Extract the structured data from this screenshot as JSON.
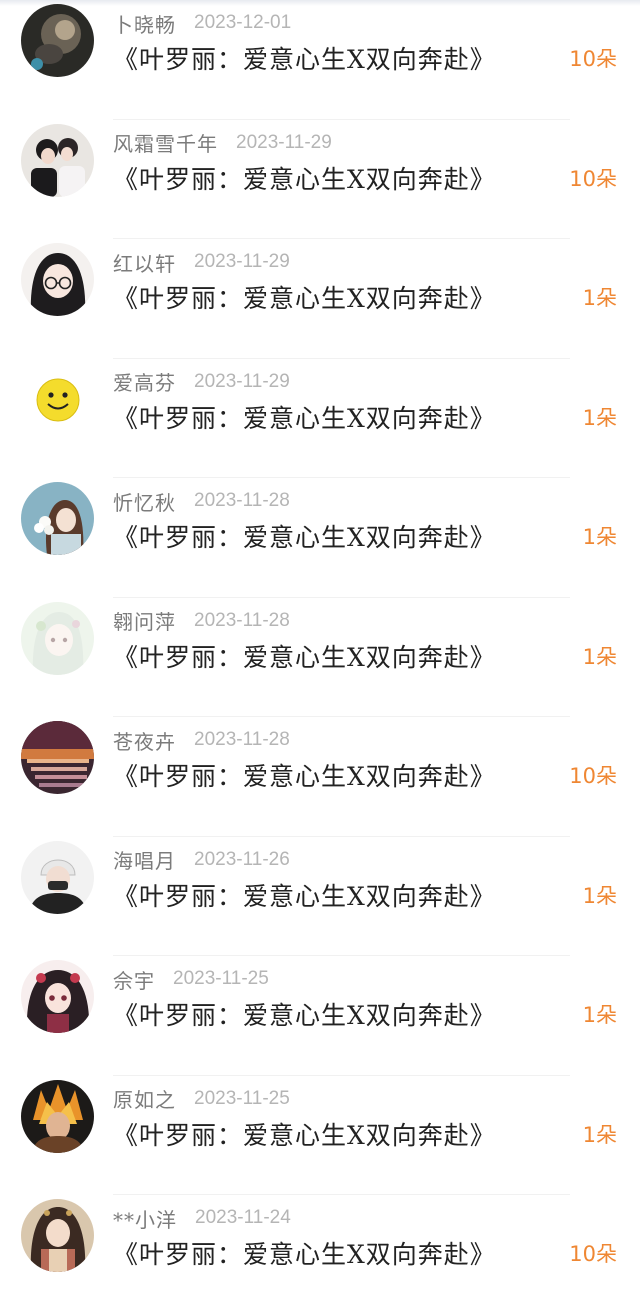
{
  "list": {
    "items": [
      {
        "user": "卜晓畅",
        "date": "2023-12-01",
        "gift": "《叶罗丽：爱意心生X双向奔赴》",
        "amount": "10朵",
        "avatar": "dark-photo-avatar"
      },
      {
        "user": "风霜雪千年",
        "date": "2023-11-29",
        "gift": "《叶罗丽：爱意心生X双向奔赴》",
        "amount": "10朵",
        "avatar": "couple-avatar"
      },
      {
        "user": "红以轩",
        "date": "2023-11-29",
        "gift": "《叶罗丽：爱意心生X双向奔赴》",
        "amount": "1朵",
        "avatar": "glasses-girl-avatar"
      },
      {
        "user": "爱高芬",
        "date": "2023-11-29",
        "gift": "《叶罗丽：爱意心生X双向奔赴》",
        "amount": "1朵",
        "avatar": "smiley-avatar"
      },
      {
        "user": "忻忆秋",
        "date": "2023-11-28",
        "gift": "《叶罗丽：爱意心生X双向奔赴》",
        "amount": "1朵",
        "avatar": "flower-girl-avatar"
      },
      {
        "user": "翱问萍",
        "date": "2023-11-28",
        "gift": "《叶罗丽：爱意心生X双向奔赴》",
        "amount": "1朵",
        "avatar": "pastel-girl-avatar"
      },
      {
        "user": "苍夜卉",
        "date": "2023-11-28",
        "gift": "《叶罗丽：爱意心生X双向奔赴》",
        "amount": "10朵",
        "avatar": "sunset-avatar"
      },
      {
        "user": "海唱月",
        "date": "2023-11-26",
        "gift": "《叶罗丽：爱意心生X双向奔赴》",
        "amount": "1朵",
        "avatar": "masked-boy-avatar"
      },
      {
        "user": "佘宇",
        "date": "2023-11-25",
        "gift": "《叶罗丽：爱意心生X双向奔赴》",
        "amount": "1朵",
        "avatar": "anime-girl-avatar"
      },
      {
        "user": "原如之",
        "date": "2023-11-25",
        "gift": "《叶罗丽：爱意心生X双向奔赴》",
        "amount": "1朵",
        "avatar": "fire-girl-avatar"
      },
      {
        "user": "**小洋",
        "date": "2023-11-24",
        "gift": "《叶罗丽：爱意心生X双向奔赴》",
        "amount": "10朵",
        "avatar": "traditional-girl-avatar"
      }
    ]
  },
  "colors": {
    "amount": "#ef8733",
    "username": "#7b7b7b",
    "date": "#b5b5b5",
    "gift_title": "#222222"
  }
}
